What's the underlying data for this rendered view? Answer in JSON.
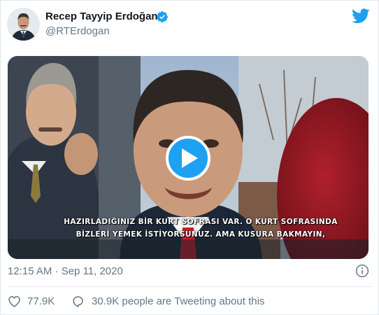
{
  "tweet": {
    "author": {
      "display_name": "Recep Tayyip Erdoğan",
      "handle": "@RTErdogan",
      "verified": true,
      "avatar_icon": "profile-photo"
    },
    "media": {
      "type": "video",
      "subtitle_line_1": "HAZIRLADIĞINIZ BİR KURT SOFRASI VAR. O KURT SOFRASINDA",
      "subtitle_line_2": "BİZLERİ YEMEK İSTİYORSUNUZ. AMA KUSURA BAKMAYIN,",
      "play_icon": "play-icon"
    },
    "timestamp": "12:15 AM · Sep 11, 2020",
    "likes": "77.9K",
    "tweeting_about": "30.9K people are Tweeting about this"
  },
  "colors": {
    "brand_blue": "#1da1f2",
    "text_primary": "#14171a",
    "text_secondary": "#657786",
    "divider": "#e6ecf0"
  },
  "icons": {
    "logo": "twitter-bird-icon",
    "verified": "verified-badge-icon",
    "info": "info-icon",
    "like": "heart-icon",
    "reply": "speech-bubble-icon"
  }
}
